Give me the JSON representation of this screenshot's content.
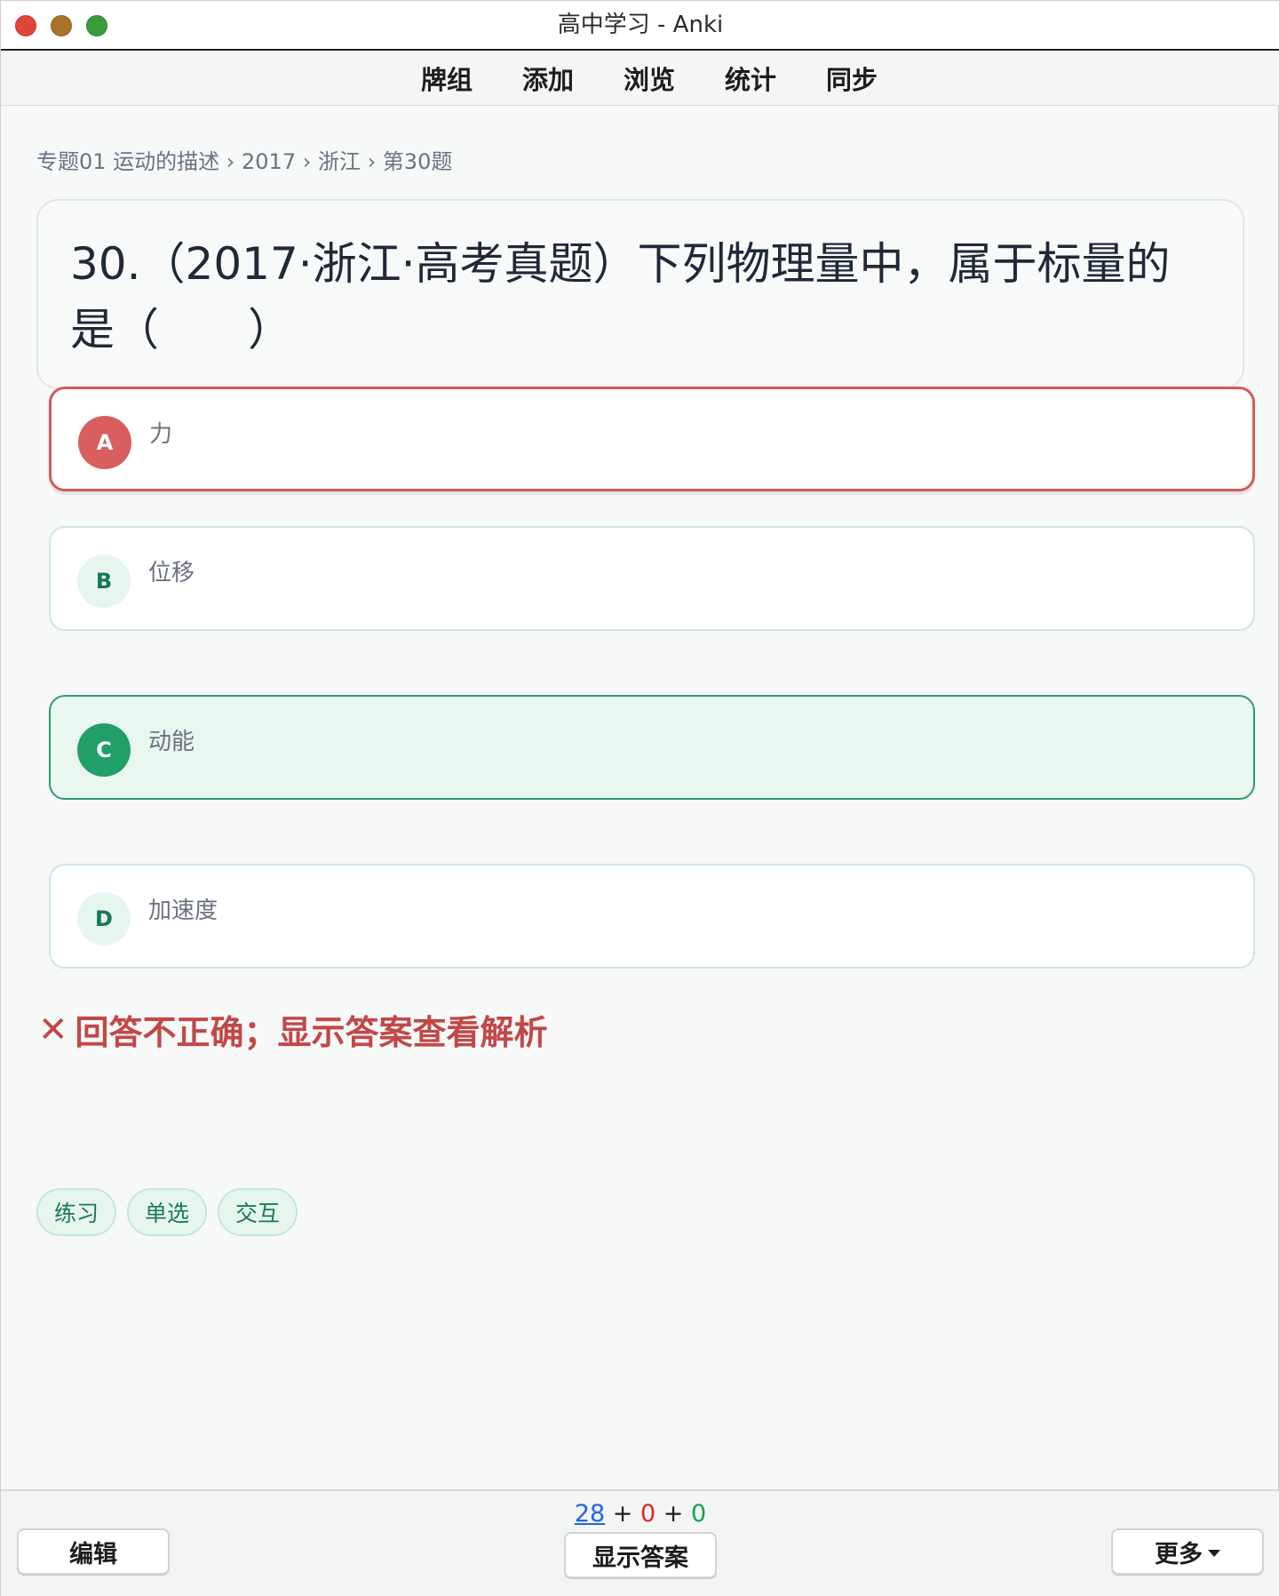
{
  "window": {
    "title": "高中学习 - Anki"
  },
  "nav": {
    "decks": "牌组",
    "add": "添加",
    "browse": "浏览",
    "stats": "统计",
    "sync": "同步"
  },
  "breadcrumb": "专题01 运动的描述 › 2017 › 浙江 › 第30题",
  "question": {
    "line1": "30.（2017·浙江·高考真题）下列物理量中，属于标量的",
    "line2": "是（　　）"
  },
  "options": [
    {
      "letter": "A",
      "text": "力",
      "state": "selected-wrong"
    },
    {
      "letter": "B",
      "text": "位移",
      "state": "normal"
    },
    {
      "letter": "C",
      "text": "动能",
      "state": "correct"
    },
    {
      "letter": "D",
      "text": "加速度",
      "state": "normal"
    }
  ],
  "result": {
    "icon": "✕",
    "text": "回答不正确；显示答案查看解析"
  },
  "tags": [
    "练习",
    "单选",
    "交互"
  ],
  "bottom": {
    "count_new": "28",
    "count_learn": "0",
    "count_review": "0",
    "plus": "+",
    "edit": "编辑",
    "show_answer": "显示答案",
    "more": "更多"
  },
  "colors": {
    "wrong": "#d45a5a",
    "correct": "#229e68",
    "new_count": "#2563eb",
    "learn_count": "#dc2626",
    "review_count": "#16a34a"
  }
}
